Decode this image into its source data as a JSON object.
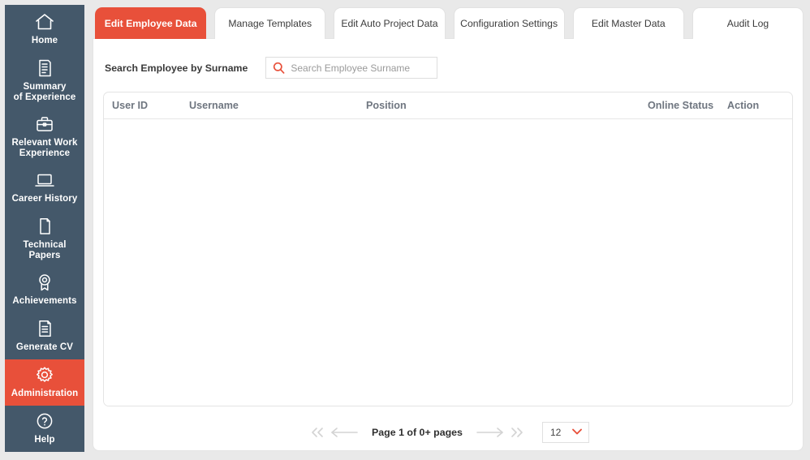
{
  "theme": {
    "accent": "#e8503a",
    "sidebar_bg": "#44586a",
    "page_bg": "#e9e9e9",
    "header_text": "#6f7680"
  },
  "sidebar": {
    "items": [
      {
        "label": "Home",
        "icon": "home-icon",
        "active": false
      },
      {
        "label": "Summary\nof Experience",
        "icon": "document-lines-icon",
        "active": false
      },
      {
        "label": "Relevant Work\nExperience",
        "icon": "briefcase-icon",
        "active": false
      },
      {
        "label": "Career History",
        "icon": "laptop-icon",
        "active": false
      },
      {
        "label": "Technical Papers",
        "icon": "page-icon",
        "active": false
      },
      {
        "label": "Achievements",
        "icon": "award-ribbon-icon",
        "active": false
      },
      {
        "label": "Generate CV",
        "icon": "document-list-icon",
        "active": false
      },
      {
        "label": "Administration",
        "icon": "gear-icon",
        "active": true
      },
      {
        "label": "Help",
        "icon": "question-circle-icon",
        "active": false
      }
    ]
  },
  "tabs": [
    {
      "label": "Edit Employee Data",
      "active": true
    },
    {
      "label": "Manage Templates",
      "active": false
    },
    {
      "label": "Edit Auto Project Data",
      "active": false
    },
    {
      "label": "Configuration Settings",
      "active": false
    },
    {
      "label": "Edit Master Data",
      "active": false
    },
    {
      "label": "Audit Log",
      "active": false
    }
  ],
  "search": {
    "label": "Search Employee by Surname",
    "placeholder": "Search Employee Surname",
    "value": "",
    "icon": "search-icon"
  },
  "table": {
    "columns": [
      "User ID",
      "Username",
      "Position",
      "Online Status",
      "Action"
    ],
    "rows": []
  },
  "pagination": {
    "first_icon": "double-chevron-left-icon",
    "prev_icon": "arrow-left-icon",
    "page_label": "Page 1 of 0+ pages",
    "next_icon": "arrow-right-icon",
    "last_icon": "double-chevron-right-icon",
    "page_size": "12",
    "page_size_icon": "chevron-down-icon"
  }
}
